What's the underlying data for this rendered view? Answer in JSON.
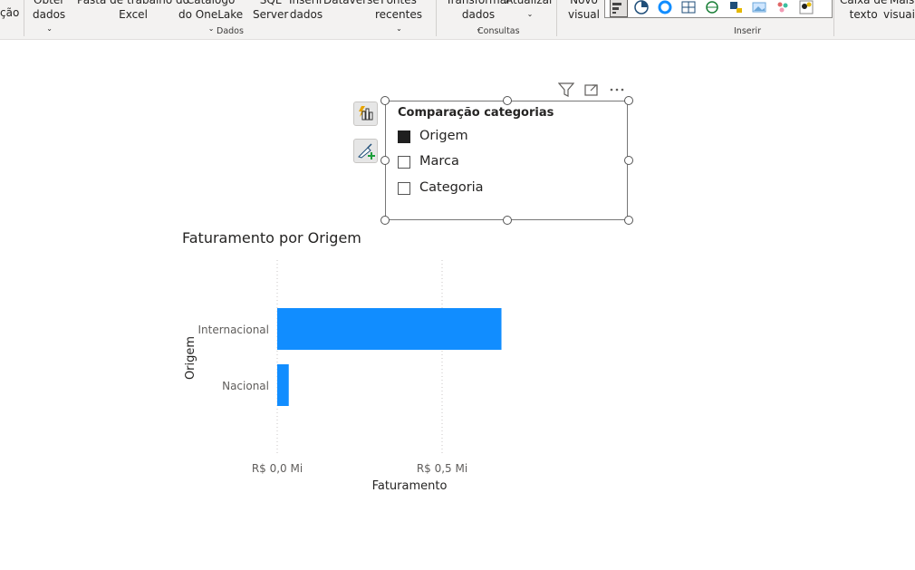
{
  "ribbon": {
    "partial_left": "ção",
    "buttons": [
      {
        "id": "obter-dados",
        "l1": "Obter",
        "l2": "dados",
        "chev": true
      },
      {
        "id": "pasta-trabalho-excel",
        "l1": "Pasta de trabalho do",
        "l2": "Excel",
        "chev": false
      },
      {
        "id": "catalogo-onelake",
        "l1": "Catálogo",
        "l2": "do OneLake",
        "chev": true
      },
      {
        "id": "sql-server",
        "l1": "SQL",
        "l2": "Server",
        "chev": false
      },
      {
        "id": "inserir-dados",
        "l1": "Inserir",
        "l2": "dados",
        "chev": false
      },
      {
        "id": "dataverse",
        "l1": "Dataverse",
        "l2": "",
        "chev": false
      },
      {
        "id": "fontes-recentes",
        "l1": "Fontes",
        "l2": "recentes",
        "chev": true
      },
      {
        "id": "transformar-dados",
        "l1": "Transformar",
        "l2": "dados",
        "chev": true
      },
      {
        "id": "atualizar",
        "l1": "Atualizar",
        "l2": "",
        "chev": true
      },
      {
        "id": "novo-visual",
        "l1": "Novo",
        "l2": "visual",
        "chev": false
      },
      {
        "id": "caixa-texto",
        "l1": "Caixa de",
        "l2": "texto",
        "chev": false
      },
      {
        "id": "mais-visuais",
        "l1": "Mais",
        "l2": "visuais",
        "chev": false
      }
    ],
    "groups": {
      "dados": "Dados",
      "consultas": "Consultas",
      "inserir": "Inserir"
    }
  },
  "slicer": {
    "title": "Comparação categorias",
    "options": [
      {
        "label": "Origem",
        "checked": true
      },
      {
        "label": "Marca",
        "checked": false
      },
      {
        "label": "Categoria",
        "checked": false
      }
    ]
  },
  "chart_title": "Faturamento por Origem",
  "chart_data": {
    "type": "bar",
    "orientation": "horizontal",
    "title": "Faturamento por Origem",
    "categories": [
      "Internacional",
      "Nacional"
    ],
    "values": [
      0.68,
      0.035
    ],
    "unit": "R$ Mi",
    "xlim": [
      0,
      1.0
    ],
    "ticks": [
      {
        "value": 0,
        "label": "R$ 0,0 Mi"
      },
      {
        "value": 0.5,
        "label": "R$ 0,5 Mi"
      }
    ],
    "xlabel": "Faturamento",
    "ylabel": "Origem",
    "grid": true,
    "colors": {
      "bar": "#118dff",
      "grid": "#c8c6c4"
    }
  }
}
